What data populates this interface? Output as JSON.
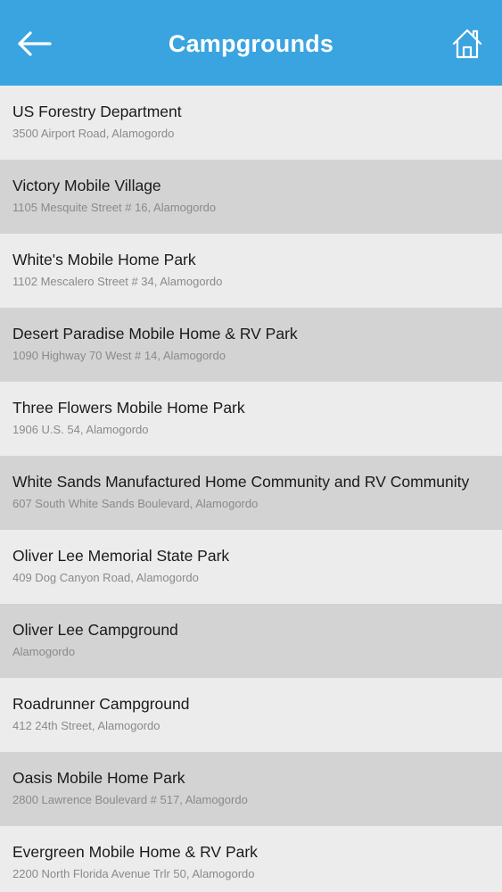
{
  "header": {
    "title": "Campgrounds",
    "background_color": "#3aa4e1",
    "back_icon": "arrow-left-icon",
    "home_icon": "home-icon"
  },
  "campgrounds": [
    {
      "name": "US Forestry Department",
      "address": "3500 Airport Road, Alamogordo"
    },
    {
      "name": "Victory Mobile Village",
      "address": "1105 Mesquite Street # 16, Alamogordo"
    },
    {
      "name": "White's Mobile Home Park",
      "address": "1102 Mescalero Street # 34, Alamogordo"
    },
    {
      "name": "Desert Paradise Mobile Home & RV Park",
      "address": "1090 Highway 70 West # 14, Alamogordo"
    },
    {
      "name": "Three Flowers Mobile Home Park",
      "address": "1906 U.S. 54, Alamogordo"
    },
    {
      "name": "White Sands Manufactured Home Community and RV Community",
      "address": "607 South White Sands Boulevard, Alamogordo"
    },
    {
      "name": "Oliver Lee Memorial State Park",
      "address": "409 Dog Canyon Road, Alamogordo"
    },
    {
      "name": "Oliver Lee Campground",
      "address": "Alamogordo"
    },
    {
      "name": "Roadrunner Campground",
      "address": "412 24th Street, Alamogordo"
    },
    {
      "name": "Oasis Mobile Home Park",
      "address": "2800 Lawrence Boulevard # 517, Alamogordo"
    },
    {
      "name": "Evergreen Mobile Home & RV Park",
      "address": "2200 North Florida Avenue Trlr 50, Alamogordo"
    }
  ]
}
